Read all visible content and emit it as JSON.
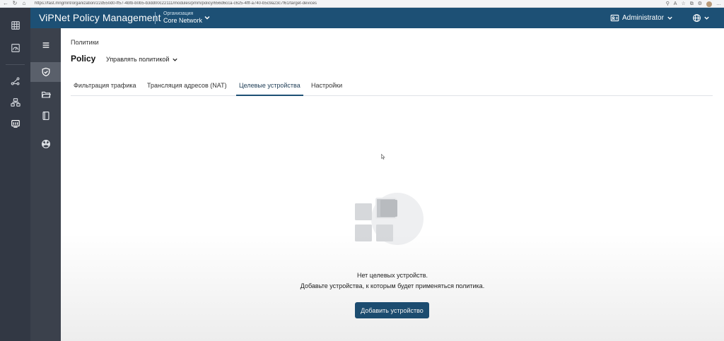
{
  "browser": {
    "url": "https://fast.mngmnt/organization/22d550d0-ff57-4bfb-b0b5-b3dd00c22111/modules/pmm/policy/656d6cca-c625-4fff-a740-b5c9a23c7f61/target-devices"
  },
  "header": {
    "app_title": "ViPNet Policy Management",
    "org_label": "Организация",
    "org_value": "Core Network",
    "user": "Administrator"
  },
  "breadcrumb": "Политики",
  "page": {
    "title": "Policy",
    "manage_label": "Управлять политикой"
  },
  "tabs": [
    {
      "label": "Фильтрация трафика"
    },
    {
      "label": "Трансляция адресов (NAT)"
    },
    {
      "label": "Целевые устройства",
      "active": true
    },
    {
      "label": "Настройки"
    }
  ],
  "empty_state": {
    "line1": "Нет целевых устройств.",
    "line2": "Добавьте устройства, к которым будет применяться политика.",
    "button": "Добавить устройство"
  },
  "icons": {
    "rail": [
      "grid-icon",
      "dashboard-icon",
      "topology-icon",
      "network-icon",
      "monitor-icon"
    ],
    "sidebar": [
      "menu-icon",
      "shield-check-icon",
      "folder-icon",
      "notebook-icon",
      "radiation-icon"
    ]
  },
  "colors": {
    "header": "#1d5075",
    "rail": "#323844",
    "sidebar": "#3b414c",
    "accent": "#1d5075"
  }
}
